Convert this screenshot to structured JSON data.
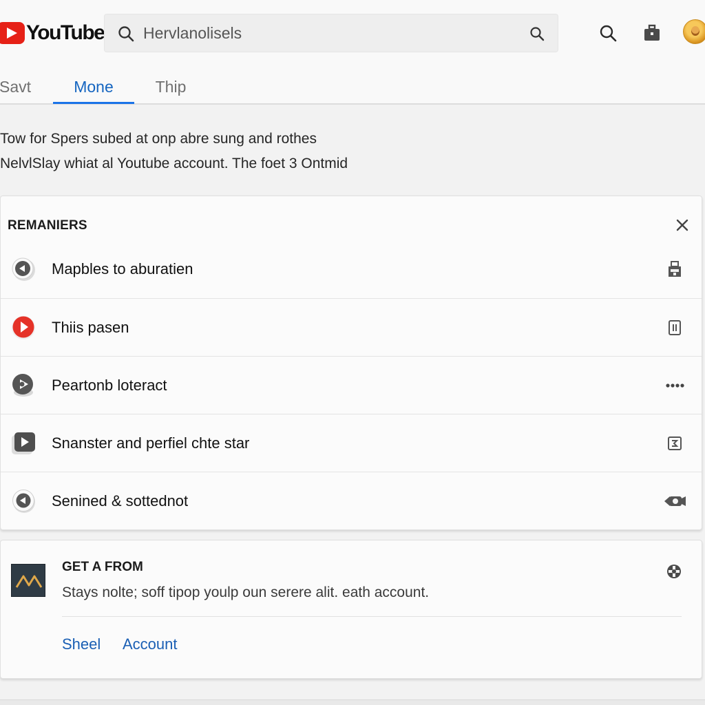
{
  "header": {
    "logo_text": "YouTube",
    "search": {
      "value": "",
      "placeholder": "Hervlanolisels"
    }
  },
  "tabs": [
    {
      "label": "Savt",
      "active": false
    },
    {
      "label": "Mone",
      "active": true
    },
    {
      "label": "Thip",
      "active": false
    }
  ],
  "intro": {
    "line1": "Tow for Spers subed at onp abre sung and rothes",
    "line2": "NelvlSlay whiat al Youtube account. The foet 3 Ontmid"
  },
  "reminders": {
    "title": "REMANIERS",
    "items": [
      {
        "label": "Mapbles to aburatien",
        "icon": "back-circle-icon",
        "trailing_icon": "lock-icon"
      },
      {
        "label": "Thiis pasen",
        "icon": "red-play-icon",
        "trailing_icon": "document-icon"
      },
      {
        "label": "Peartonb loteract",
        "icon": "play-circle-icon",
        "trailing_icon": "more-dots-icon"
      },
      {
        "label": "Snanster and perfiel chte star",
        "icon": "play-square-icon",
        "trailing_icon": "export-icon"
      },
      {
        "label": "Senined & sottednot",
        "icon": "back-circle-icon",
        "trailing_icon": "camera-icon"
      }
    ]
  },
  "get_card": {
    "title": "GET A FROM",
    "description": "Stays nolte; soff tipop youlp oun serere alit. eath account.",
    "links": [
      "Sheel",
      "Account"
    ]
  },
  "colors": {
    "brand_red": "#e62117",
    "accent_blue": "#1a73e8",
    "link_blue": "#1a5fb4"
  }
}
